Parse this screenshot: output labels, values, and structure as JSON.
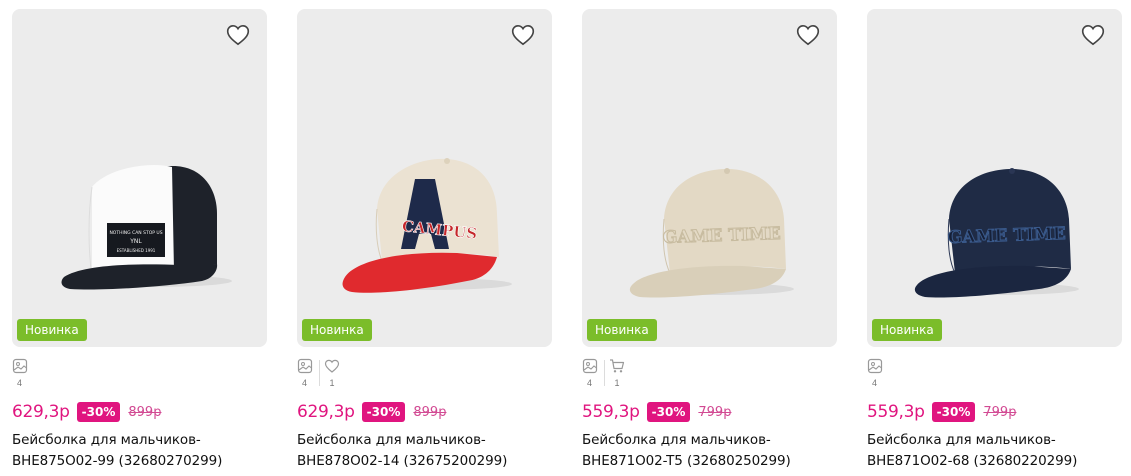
{
  "colors": {
    "accent": "#e0157f",
    "badge_new": "#7bbd2a",
    "image_bg": "#ececec"
  },
  "products": [
    {
      "badge": "Новинка",
      "photos_count": "4",
      "favorites_count": "",
      "cart_count": "",
      "price": "629,3р",
      "discount": "-30%",
      "old_price": "899р",
      "title_line1": "Бейсболка для мальчиков-",
      "title_line2": "BHE875O02-99 (32680270299)",
      "icons": [
        "heart-outline-icon",
        "photo-icon"
      ]
    },
    {
      "badge": "Новинка",
      "photos_count": "4",
      "favorites_count": "1",
      "cart_count": "",
      "price": "629,3р",
      "discount": "-30%",
      "old_price": "899р",
      "title_line1": "Бейсболка для мальчиков-",
      "title_line2": "BHE878O02-14 (32675200299)",
      "icons": [
        "heart-outline-icon",
        "photo-icon",
        "heart-small-icon"
      ]
    },
    {
      "badge": "Новинка",
      "photos_count": "4",
      "favorites_count": "",
      "cart_count": "1",
      "price": "559,3р",
      "discount": "-30%",
      "old_price": "799р",
      "title_line1": "Бейсболка для мальчиков-",
      "title_line2": "BHE871O02-T5 (32680250299)",
      "icons": [
        "heart-outline-icon",
        "photo-icon",
        "cart-icon"
      ]
    },
    {
      "badge": "Новинка",
      "photos_count": "4",
      "favorites_count": "",
      "cart_count": "",
      "price": "559,3р",
      "discount": "-30%",
      "old_price": "799р",
      "title_line1": "Бейсболка для мальчиков-",
      "title_line2": "BHE871O02-68 (32680220299)",
      "icons": [
        "heart-outline-icon",
        "photo-icon"
      ]
    }
  ]
}
